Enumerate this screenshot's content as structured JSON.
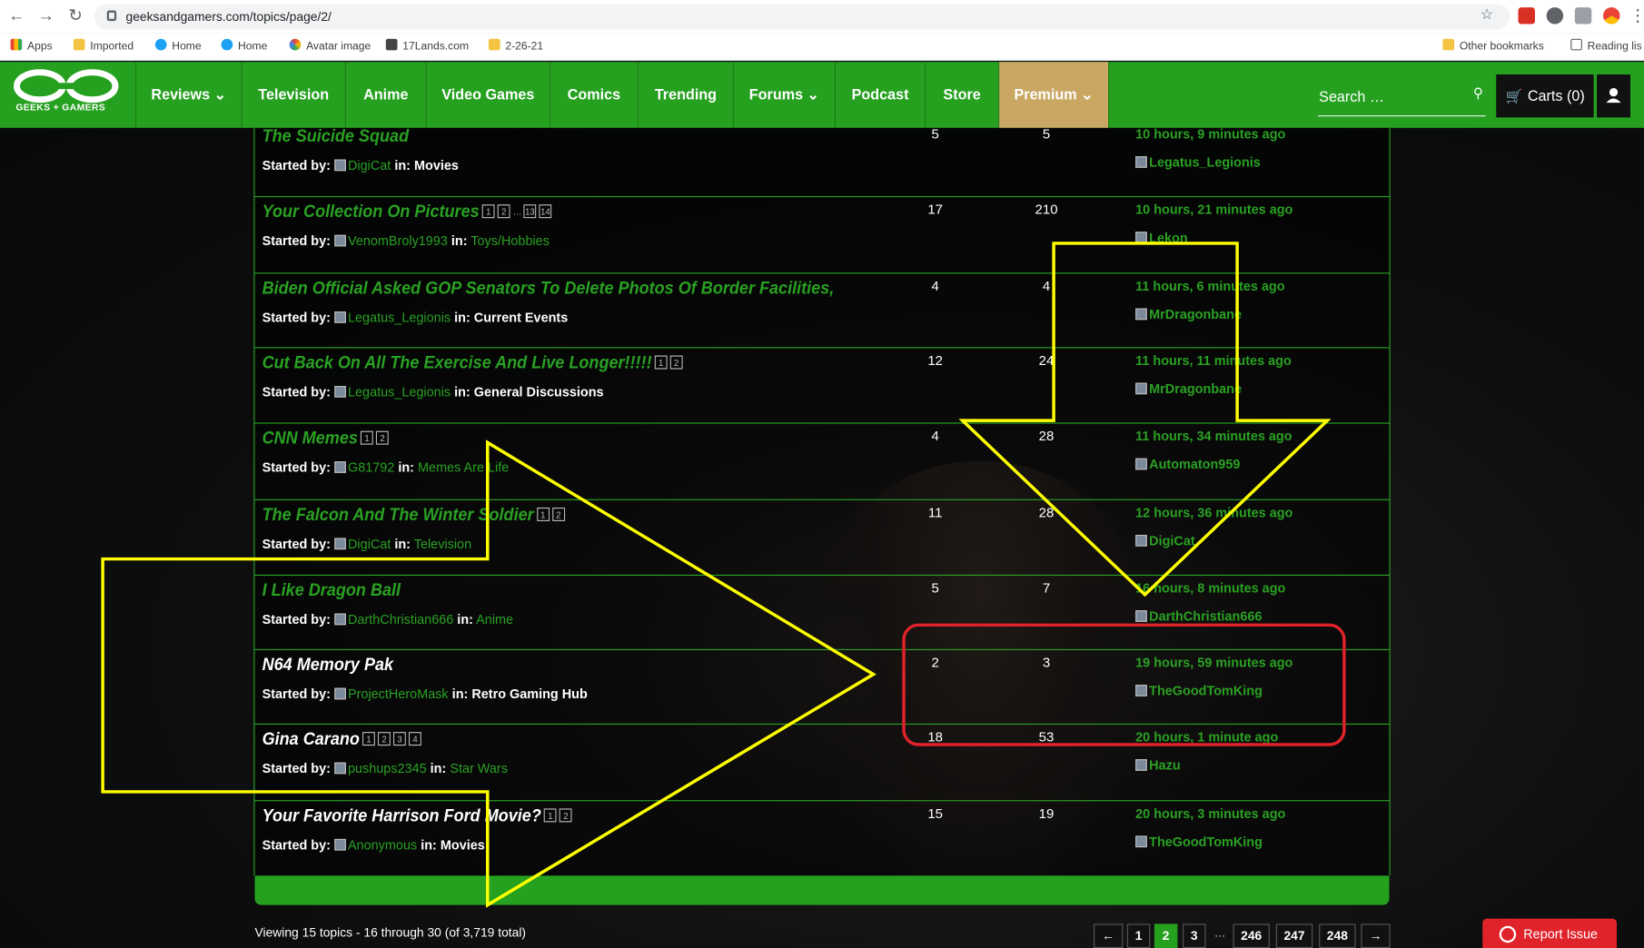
{
  "browser": {
    "url": "geeksandgamers.com/topics/page/2/",
    "bookmarks": [
      "Apps",
      "Imported",
      "Home",
      "Home",
      "Avatar image",
      "17Lands.com",
      "2-26-21"
    ],
    "other_bookmarks": "Other bookmarks",
    "reading_list": "Reading lis"
  },
  "site": {
    "logo_text": "GEEKS + GAMERS",
    "nav": [
      "Reviews",
      "Television",
      "Anime",
      "Video Games",
      "Comics",
      "Trending",
      "Forums",
      "Podcast",
      "Store",
      "Premium"
    ],
    "search_placeholder": "Search …",
    "cart": "Carts (0)"
  },
  "topics": [
    {
      "title": "The Suicide Squad",
      "pages": [],
      "author": "DigiCat",
      "forum": "Movies",
      "forum_color": "white",
      "voices": "5",
      "posts": "5",
      "fresh": "10 hours, 9 minutes ago",
      "fresh_user": "Legatus_Legionis"
    },
    {
      "title": "Your Collection On Pictures",
      "pages": [
        "1",
        "2",
        "…",
        "13",
        "14"
      ],
      "author": "VenomBroly1993",
      "forum": "Toys/Hobbies",
      "forum_color": "green",
      "voices": "17",
      "posts": "210",
      "fresh": "10 hours, 21 minutes ago",
      "fresh_user": "Lekon"
    },
    {
      "title": "Biden Official Asked GOP Senators To Delete Photos Of Border Facilities,",
      "pages": [],
      "author": "Legatus_Legionis",
      "forum": "Current Events",
      "forum_color": "white",
      "voices": "4",
      "posts": "4",
      "fresh": "11 hours, 6 minutes ago",
      "fresh_user": "MrDragonbane"
    },
    {
      "title": "Cut Back On All The Exercise And Live Longer!!!!!",
      "pages": [
        "1",
        "2"
      ],
      "author": "Legatus_Legionis",
      "forum": "General Discussions",
      "forum_color": "white",
      "voices": "12",
      "posts": "24",
      "fresh": "11 hours, 11 minutes ago",
      "fresh_user": "MrDragonbane"
    },
    {
      "title": "CNN Memes",
      "pages": [
        "1",
        "2"
      ],
      "author": "G81792",
      "forum": "Memes Are Life",
      "forum_color": "green",
      "voices": "4",
      "posts": "28",
      "fresh": "11 hours, 34 minutes ago",
      "fresh_user": "Automaton959"
    },
    {
      "title": "The Falcon And The Winter Soldier",
      "pages": [
        "1",
        "2"
      ],
      "author": "DigiCat",
      "forum": "Television",
      "forum_color": "green",
      "voices": "11",
      "posts": "28",
      "fresh": "12 hours, 36 minutes ago",
      "fresh_user": "DigiCat"
    },
    {
      "title": "I Like Dragon Ball",
      "pages": [],
      "author": "DarthChristian666",
      "forum": "Anime",
      "forum_color": "green",
      "voices": "5",
      "posts": "7",
      "fresh": "16 hours, 8 minutes ago",
      "fresh_user": "DarthChristian666"
    },
    {
      "title": "N64 Memory Pak",
      "pages": [],
      "author": "ProjectHeroMask",
      "forum": "Retro Gaming Hub",
      "forum_color": "white",
      "voices": "2",
      "posts": "3",
      "fresh": "19 hours, 59 minutes ago",
      "fresh_user": "TheGoodTomKing",
      "white": true
    },
    {
      "title": "Gina Carano",
      "pages": [
        "1",
        "2",
        "3",
        "4"
      ],
      "author": "pushups2345",
      "forum": "Star Wars",
      "forum_color": "green",
      "voices": "18",
      "posts": "53",
      "fresh": "20 hours, 1 minute ago",
      "fresh_user": "Hazu",
      "white": true
    },
    {
      "title": "Your Favorite Harrison Ford Movie?",
      "pages": [
        "1",
        "2"
      ],
      "author": "Anonymous",
      "forum": "Movies",
      "forum_color": "white",
      "voices": "15",
      "posts": "19",
      "fresh": "20 hours, 3 minutes ago",
      "fresh_user": "TheGoodTomKing",
      "white": true
    }
  ],
  "labels": {
    "started_by": "Started by:",
    "in": "in:"
  },
  "footer": {
    "viewing": "Viewing 15 topics - 16 through 30 (of 3,719 total)",
    "pages": [
      "←",
      "1",
      "2",
      "3",
      "246",
      "247",
      "248",
      "→"
    ],
    "current_page": "2",
    "report": "Report Issue"
  },
  "colors": {
    "brand_green": "#25a11f",
    "premium_gold": "#c9a763",
    "annotation_yellow": "#ffff00",
    "annotation_red": "#e0222a",
    "report_red": "#e0222a"
  }
}
